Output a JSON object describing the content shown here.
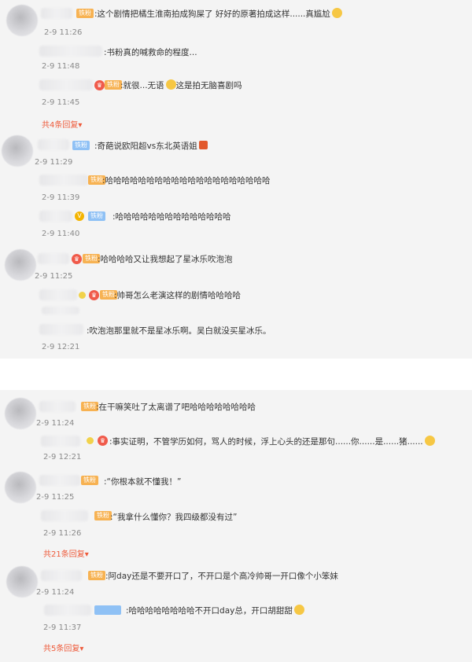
{
  "badges": {
    "fan": "铁粉"
  },
  "panel1": {
    "comments": [
      {
        "text": ":这个剧情把橘生淮南拍成狗屎了 好好的原著拍成这样......真尴尬",
        "time": "2-9 11:26"
      },
      {
        "text": ":书粉真的喊救命的程度...",
        "time": "2-9 11:48"
      },
      {
        "text": ":就很...无语",
        "text_after": "这是拍无脑喜剧吗",
        "time": "2-9 11:45"
      },
      {
        "more": "共4条回复"
      },
      {
        "text": ":奇葩说欧阳超vs东北英语姐",
        "time": "2-9 11:29"
      },
      {
        "text": ":哈哈哈哈哈哈哈哈哈哈哈哈哈哈哈哈哈哈哈哈",
        "time": "2-9 11:39"
      },
      {
        "text": ":哈哈哈哈哈哈哈哈哈哈哈哈哈哈",
        "time": "2-9 11:40"
      },
      {
        "text": ":哈哈哈哈又让我想起了星冰乐吹泡泡",
        "time": "2-9 11:25"
      },
      {
        "text": ":帅哥怎么老演这样的剧情哈哈哈哈",
        "time": ""
      },
      {
        "text": ":吹泡泡那里就不是星冰乐啊。吴白就没买星冰乐。",
        "time": "2-9 12:21"
      }
    ]
  },
  "panel2": {
    "comments": [
      {
        "text": ":在干嘛笑吐了太离谱了吧哈哈哈哈哈哈哈哈",
        "time": "2-9 11:24"
      },
      {
        "text": ":事实证明，不管学历如何，骂人的时候，浮上心头的还是那句......你......是......猪......",
        "time": "2-9 12:21"
      },
      {
        "text": ":“你根本就不懂我！”",
        "time": "2-9 11:25"
      },
      {
        "text": ":“我拿什么懂你？我四级都没有过”",
        "time": "2-9 11:26"
      },
      {
        "more": "共21条回复"
      },
      {
        "text": ":阿day还是不要开口了，不开口是个高冷帅哥一开口像个小笨妹",
        "time": "2-9 11:24"
      },
      {
        "text": ":哈哈哈哈哈哈哈哈不开口day总，开口胡甜甜",
        "time": "2-9 11:37"
      },
      {
        "more": "共5条回复"
      }
    ]
  },
  "icons": {
    "more_arrow": "▾"
  }
}
